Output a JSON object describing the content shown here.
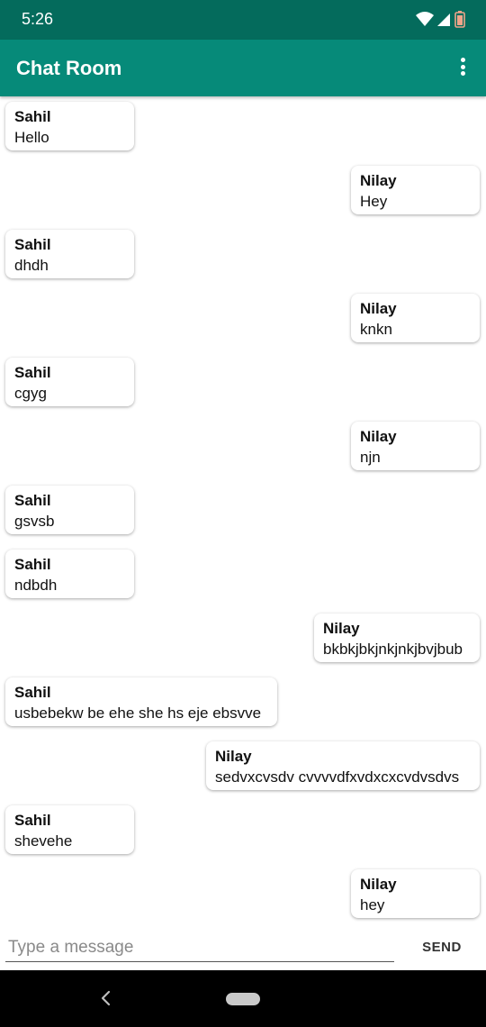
{
  "status_bar": {
    "time": "5:26",
    "icons": [
      "wifi-icon",
      "signal-icon",
      "battery-icon"
    ]
  },
  "app_bar": {
    "title": "Chat Room",
    "menu_icon": "more-vert-icon"
  },
  "messages": [
    {
      "sender": "Sahil",
      "text": "Hello",
      "side": "left"
    },
    {
      "sender": "Nilay",
      "text": "Hey",
      "side": "right"
    },
    {
      "sender": "Sahil",
      "text": "dhdh",
      "side": "left"
    },
    {
      "sender": "Nilay",
      "text": "knkn",
      "side": "right"
    },
    {
      "sender": "Sahil",
      "text": "cgyg",
      "side": "left"
    },
    {
      "sender": "Nilay",
      "text": "njn",
      "side": "right"
    },
    {
      "sender": "Sahil",
      "text": "gsvsb",
      "side": "left"
    },
    {
      "sender": "Sahil",
      "text": "ndbdh",
      "side": "left"
    },
    {
      "sender": "Nilay",
      "text": "bkbkjbkjnkjnkjbvjbub",
      "side": "right"
    },
    {
      "sender": "Sahil",
      "text": "usbebekw be ehe she hs eje ebsvve",
      "side": "left"
    },
    {
      "sender": "Nilay",
      "text": "sedvxcvsdv cvvvvdfxvdxcxcvdvsdvs",
      "side": "right"
    },
    {
      "sender": "Sahil",
      "text": "shevehe",
      "side": "left"
    },
    {
      "sender": "Nilay",
      "text": "hey",
      "side": "right"
    }
  ],
  "composer": {
    "placeholder": "Type a message",
    "value": "",
    "send_label": "SEND"
  },
  "nav_bar": {
    "icons": [
      "back-icon",
      "home-icon"
    ]
  },
  "colors": {
    "status_bar": "#046b5c",
    "app_bar": "#068a79"
  }
}
